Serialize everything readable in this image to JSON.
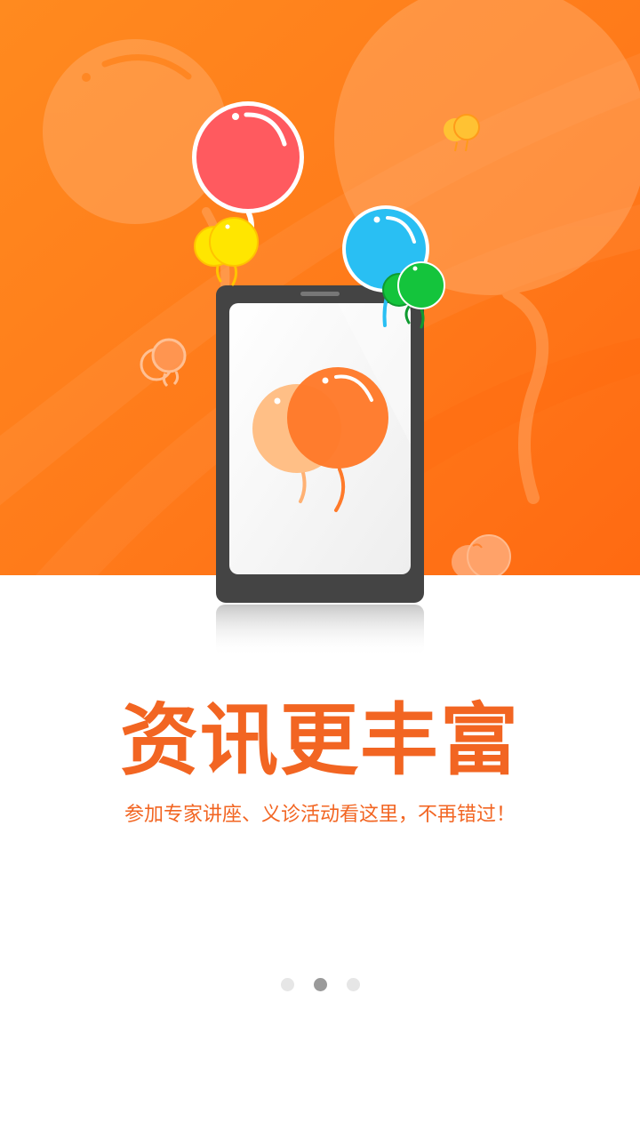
{
  "onboarding": {
    "title": "资讯更丰富",
    "subtitle": "参加专家讲座、义诊活动看这里，不再错过！",
    "page_count": 3,
    "current_page": 2
  },
  "colors": {
    "accent": "#f26522",
    "hero_orange": "#ff7a1a",
    "balloon_red": "#ff5a5f",
    "balloon_yellow": "#ffe600",
    "balloon_blue": "#29bff3",
    "balloon_green": "#14c43c",
    "phone_body": "#444444",
    "dot_active": "#9a9a9a",
    "dot_inactive": "#e6e6e6"
  },
  "icons": {
    "hero": "balloons-phone-illustration",
    "pager": "page-indicator-dots"
  }
}
